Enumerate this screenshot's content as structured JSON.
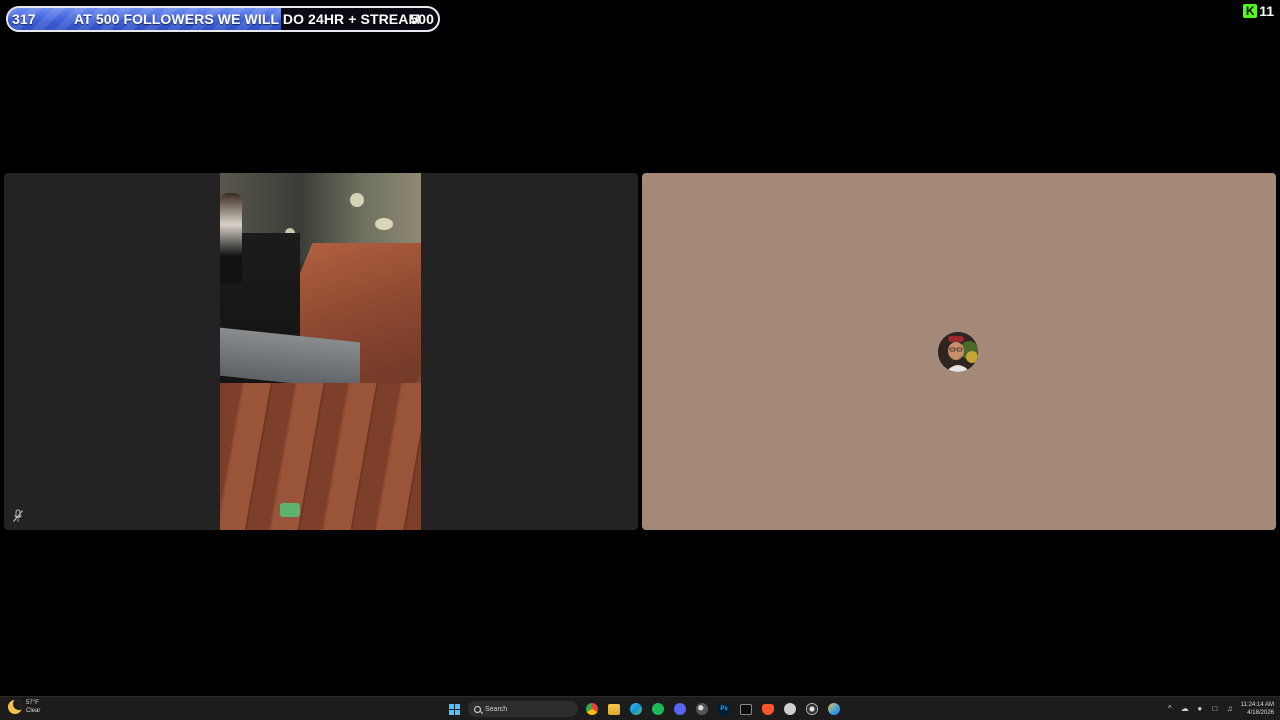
{
  "overlay": {
    "goal": {
      "current": "317",
      "title": "AT 500 FOLLOWERS WE WILL DO 24HR + STREAM",
      "target": "500",
      "progress_fraction": 0.634,
      "fill_color": "#3d5fd8"
    },
    "kick": {
      "logo_glyph": "K",
      "count": "11",
      "brand_color": "#53fc18"
    }
  },
  "call": {
    "left_tile": {
      "muted_icon": "mic-muted-icon",
      "background": "#232323"
    },
    "right_tile": {
      "avatar_icon": "user-avatar",
      "background": "#a58978"
    }
  },
  "taskbar": {
    "weather": {
      "temp": "57°F",
      "condition": "Clear",
      "icon": "moon-icon"
    },
    "search_placeholder": "Search",
    "apps": [
      {
        "name": "windows-start-icon"
      },
      {
        "name": "chrome-icon"
      },
      {
        "name": "file-explorer-icon"
      },
      {
        "name": "edge-icon"
      },
      {
        "name": "spotify-icon"
      },
      {
        "name": "discord-icon"
      },
      {
        "name": "steam-icon"
      },
      {
        "name": "photoshop-icon",
        "label": "Ps"
      },
      {
        "name": "terminal-icon"
      },
      {
        "name": "brave-icon"
      },
      {
        "name": "circle-app-icon"
      },
      {
        "name": "obs-icon"
      },
      {
        "name": "globe-app-icon"
      }
    ],
    "clock": {
      "time": "11:24:14 AM",
      "date": "4/18/2026"
    }
  }
}
